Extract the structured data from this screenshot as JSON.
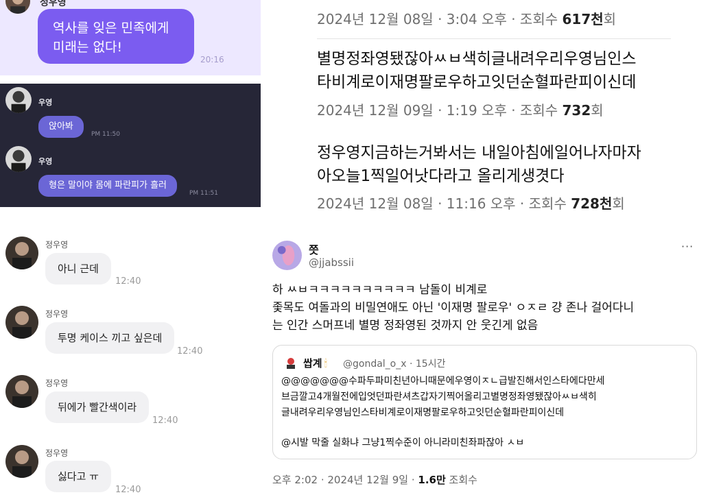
{
  "chat_purple": {
    "sender": "정우영",
    "message_line1": "역사를 잊은 민족에게",
    "message_line2": "미래는 없다!",
    "time": "20:16"
  },
  "chat_dark": {
    "messages": [
      {
        "name": "우영",
        "text": "앉아봐",
        "time": "PM 11:50"
      },
      {
        "name": "우영",
        "text": "형은 말이야 몸에 파란피가 흘러",
        "time": "PM 11:51"
      }
    ]
  },
  "chat_white": {
    "messages": [
      {
        "name": "정우영",
        "text": "아니 근데",
        "time": "12:40"
      },
      {
        "name": "정우영",
        "text": "투명 케이스 끼고 싶은데",
        "time": "12:40"
      },
      {
        "name": "정우영",
        "text": "뒤에가 빨간색이라",
        "time": "12:40"
      },
      {
        "name": "정우영",
        "text": "싫다고 ㅠ",
        "time": "12:40"
      }
    ]
  },
  "post_list": {
    "entries": [
      {
        "date": "2024년 12월 08일 · 3:04 오후 · 조회수",
        "views": "617천",
        "views_suffix": "회"
      },
      {
        "text_line1": "별명정좌영됐잖아ㅆㅂ색히글내려우리우영님인스",
        "text_line2": "타비계로이재명팔로우하고잇던순혈파란피이신데",
        "date": "2024년 12월 09일 · 1:19 오후 · 조회수",
        "views": "732",
        "views_suffix": "회"
      },
      {
        "text_line1": "정우영지금하는거봐서는 내일아침에일어나자마자",
        "text_line2": "아오늘1찍일어낫다라고 올리게생겻다",
        "date": "2024년 12월 08일 · 11:16 오후 · 조회수",
        "views": "728천",
        "views_suffix": "회"
      }
    ]
  },
  "tweet": {
    "display_name": "쯧",
    "handle": "@jjabssii",
    "more": "···",
    "lines": [
      "하 ㅆㅂㅋㅋㅋㅋㅋㅋㅋㅋㅋㅋ 남돌이 비계로",
      "좇목도 여돌과의 비밀연애도 아닌 '이재명 팔로우' ㅇㅈㄹ 걍 존나 걸어다니",
      "는 인간 스머프네 별명 정좌영된 것까지 안 웃긴게 없음"
    ],
    "quote": {
      "name": "쌉계",
      "handle_time": "@gondal_o_x · 15시간",
      "lines": [
        "@@@@@@@수파두파미친년아니때문에우영이ㅈㄴ급발진해서인스타에다만세",
        "브금깔고4개월전에입엇던파란셔츠갑자기찍어올리고별명정좌영됐잖아ㅆㅂ색히",
        "글내려우리우영님인스타비계로이재명팔로우하고잇던순혈파란피이신데"
      ],
      "line_extra": "@시발 막줄 실화냐 그냥1찍수준이 아니라미친좌파잖아 ㅅㅂ"
    },
    "footer_time": "오후 2:02 · 2024년 12월 9일 · ",
    "footer_views": "1.6만",
    "footer_views_label": " 조회수"
  }
}
